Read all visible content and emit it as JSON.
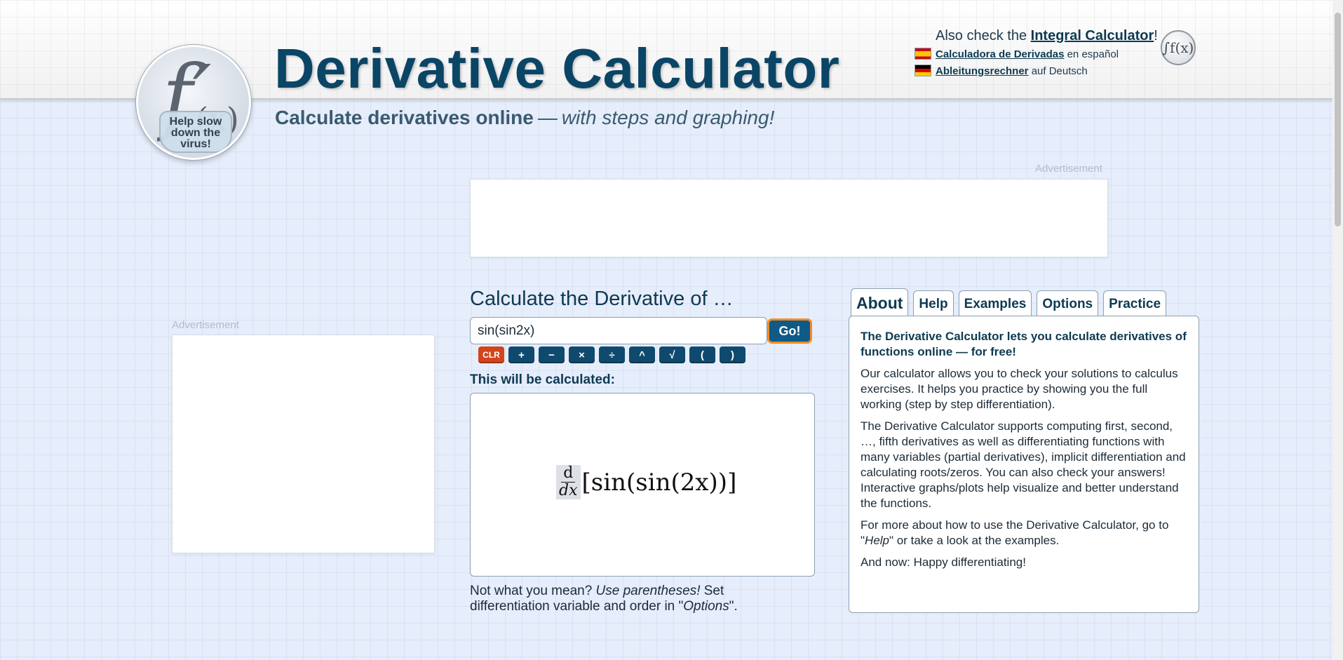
{
  "header": {
    "title": "Derivative Calculator",
    "subtitle_strong": "Calculate derivatives online",
    "subtitle_dash": "—",
    "subtitle_em": "with steps and graphing!",
    "logo": {
      "letter": "f′",
      "arg": "(x)",
      "mask_line1": "Help slow",
      "mask_line2": "down the",
      "mask_line3": "virus!"
    }
  },
  "top_links": {
    "also_prefix": "Also check the",
    "integral_link": "Integral Calculator",
    "also_suffix": "!",
    "spanish_link": "Calculadora de Derivadas",
    "spanish_suffix": "en español",
    "german_link": "Ableitungsrechner",
    "german_suffix": "auf Deutsch",
    "integral_icon": "∫f(x)"
  },
  "ads": {
    "top_label": "Advertisement",
    "side_label": "Advertisement"
  },
  "calculator": {
    "heading": "Calculate the Derivative of …",
    "input_value": "sin(sin2x)",
    "go_label": "Go!",
    "keypad": [
      "CLR",
      "+",
      "−",
      "×",
      "÷",
      "^",
      "√",
      "(",
      ")"
    ],
    "preview_label": "This will be calculated:",
    "preview_math": {
      "numerator": "d",
      "denominator": "dx",
      "expression": "[sin(sin(2x))]"
    },
    "hint": {
      "part1": "Not what you mean?",
      "part2": "Use parentheses!",
      "part3": "Set differentiation variable and order in \"",
      "part4": "Options",
      "part5": "\"."
    }
  },
  "tabs": [
    {
      "label": "About",
      "active": true
    },
    {
      "label": "Help",
      "active": false
    },
    {
      "label": "Examples",
      "active": false
    },
    {
      "label": "Options",
      "active": false
    },
    {
      "label": "Practice",
      "active": false
    }
  ],
  "about": {
    "lead": "The Derivative Calculator lets you calculate derivatives of functions online — for free!",
    "p1": "Our calculator allows you to check your solutions to calculus exercises. It helps you practice by showing you the full working (step by step differentiation).",
    "p2": "The Derivative Calculator supports computing first, second, …, fifth derivatives as well as differentiating functions with many variables (partial derivatives), implicit differentiation and calculating roots/zeros. You can also check your answers! Interactive graphs/plots help visualize and better understand the functions.",
    "p3_a": "For more about how to use the Derivative Calculator, go to \"",
    "p3_b": "Help",
    "p3_c": "\" or take a look at the examples.",
    "p4": "And now: Happy differentiating!"
  },
  "colors": {
    "brand": "#0b4566",
    "go_button": "#0f5a87",
    "go_border": "#f28c28",
    "clr_key": "#d2451a"
  }
}
